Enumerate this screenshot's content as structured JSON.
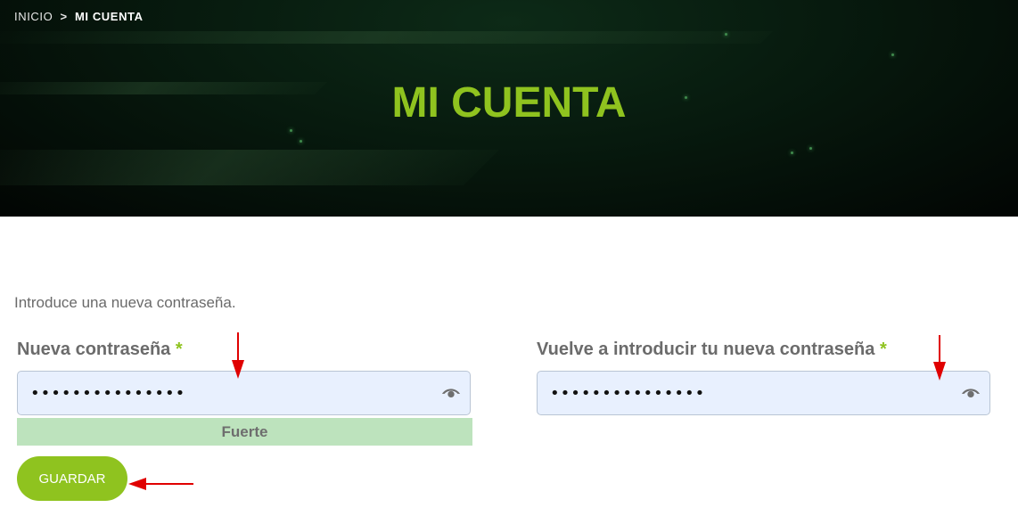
{
  "breadcrumb": {
    "home": "INICIO",
    "separator": ">",
    "current": "MI CUENTA"
  },
  "hero": {
    "title": "MI CUENTA"
  },
  "form": {
    "intro": "Introduce una nueva contraseña.",
    "new_password": {
      "label": "Nueva contraseña",
      "required_mark": "*",
      "value": "•••••••••••••••",
      "icon": "eye-icon"
    },
    "confirm_password": {
      "label": "Vuelve a introducir tu nueva contraseña",
      "required_mark": "*",
      "value": "•••••••••••••••",
      "icon": "eye-icon"
    },
    "strength": {
      "label": "Fuerte",
      "color": "#bde3bd"
    },
    "save_label": "GUARDAR"
  },
  "colors": {
    "accent": "#8fc31f",
    "hero_bg": "#061309",
    "input_bg": "#e8f0fe",
    "annotation_arrow": "#e00000"
  }
}
